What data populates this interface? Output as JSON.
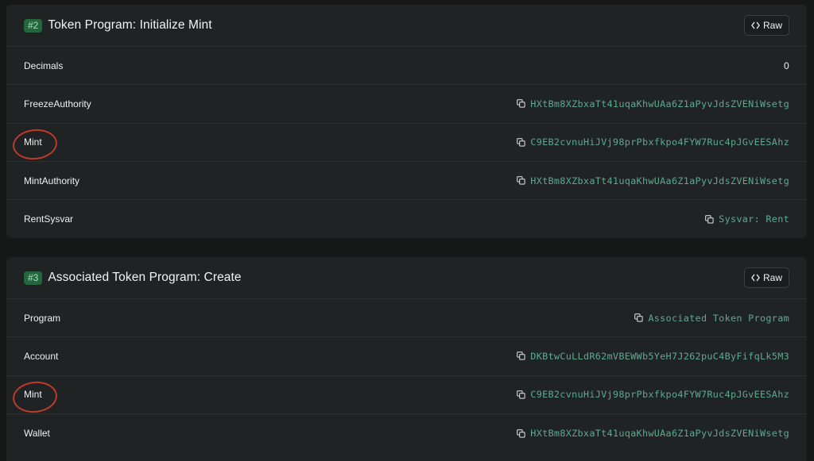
{
  "cards": [
    {
      "badge": "#2",
      "title": "Token Program: Initialize Mint",
      "raw_label": "Raw",
      "rows": [
        {
          "label": "Decimals",
          "value": "0"
        },
        {
          "label": "FreezeAuthority",
          "value": "HXtBm8XZbxaTt41uqaKhwUAa6Z1aPyvJdsZVENiWsetg"
        },
        {
          "label": "Mint",
          "value": "C9EB2cvnuHiJVj98prPbxfkpo4FYW7Ruc4pJGvEESAhz"
        },
        {
          "label": "MintAuthority",
          "value": "HXtBm8XZbxaTt41uqaKhwUAa6Z1aPyvJdsZVENiWsetg"
        },
        {
          "label": "RentSysvar",
          "value": "Sysvar: Rent"
        }
      ]
    },
    {
      "badge": "#3",
      "title": "Associated Token Program: Create",
      "raw_label": "Raw",
      "rows": [
        {
          "label": "Program",
          "value": "Associated Token Program"
        },
        {
          "label": "Account",
          "value": "DKBtwCuLLdR62mVBEWWb5YeH7J262puC4ByFifqLk5M3"
        },
        {
          "label": "Mint",
          "value": "C9EB2cvnuHiJVj98prPbxfkpo4FYW7Ruc4pJGvEESAhz"
        },
        {
          "label": "Wallet",
          "value": "HXtBm8XZbxaTt41uqaKhwUAa6Z1aPyvJdsZVENiWsetg"
        }
      ]
    }
  ],
  "icons": {
    "copy": "copy-icon",
    "code": "code-icon"
  },
  "colors": {
    "accent": "#5fa98f",
    "badge_bg": "#25663e",
    "annotation": "#c0392b"
  }
}
